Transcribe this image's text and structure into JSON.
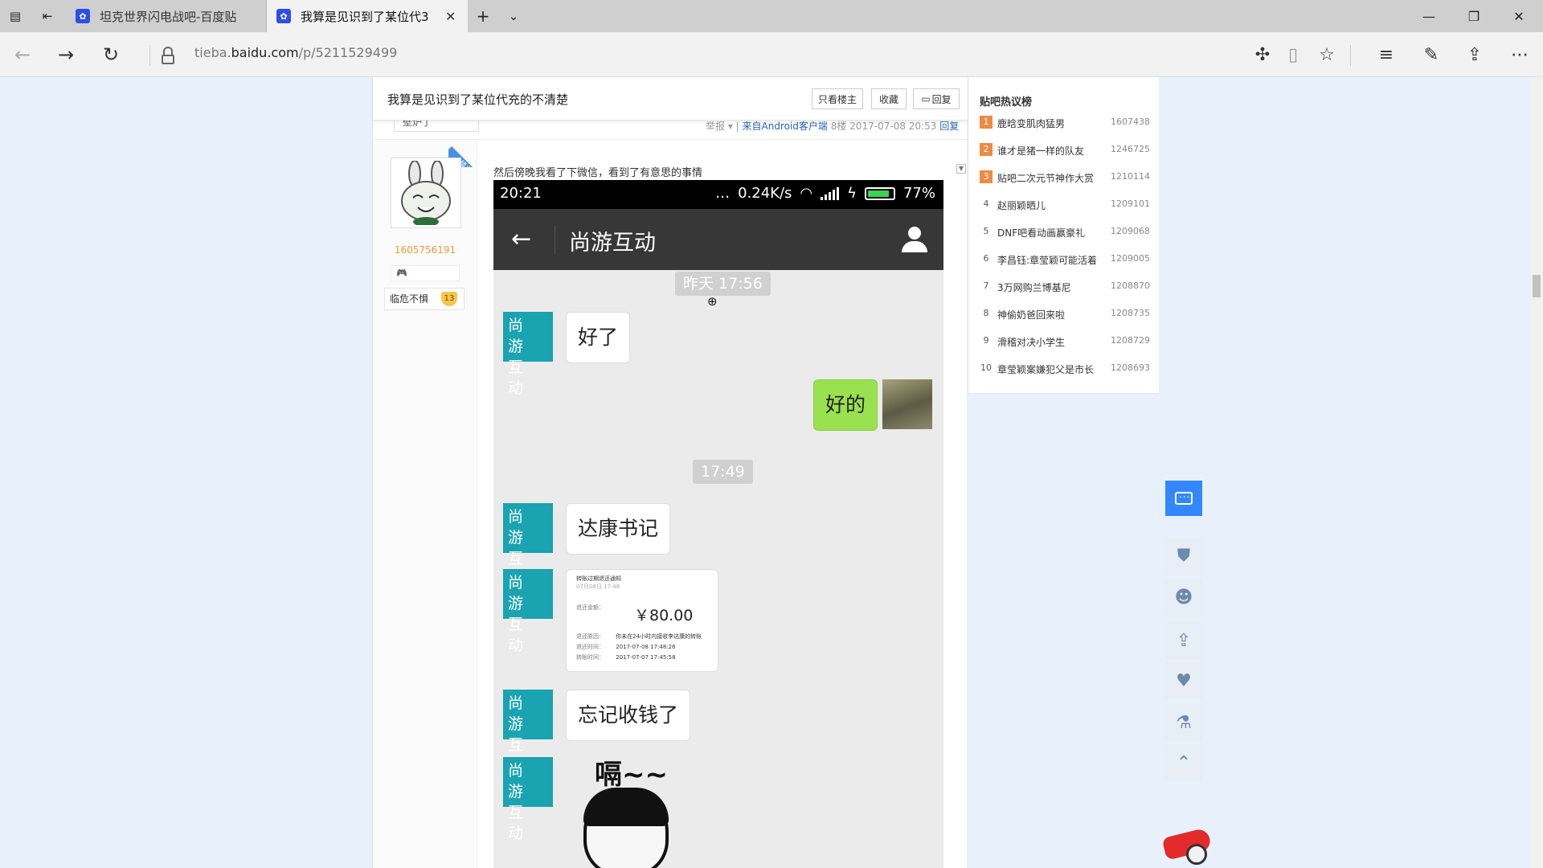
{
  "browser": {
    "tabs": [
      {
        "label": "坦克世界闪电战吧-百度贴吧",
        "active": false
      },
      {
        "label": "我算是见识到了某位代3",
        "active": true
      }
    ],
    "url_prefix": "tieba.",
    "url_domain": "baidu.com",
    "url_path": "/p/5211529499"
  },
  "thread": {
    "title": "我算是见识到了某位代充的不清楚",
    "buttons": {
      "only_op": "只看楼主",
      "favorite": "收藏",
      "reply": "回复"
    },
    "prev_meta": {
      "user": "壁炉了",
      "report": "举报",
      "from": "来自Android客户端",
      "floor": "8楼",
      "time": "2017-07-08 20:53",
      "reply": "回复"
    }
  },
  "post": {
    "username": "1605756191",
    "tag": "楼主",
    "badge2": "临危不惧",
    "level": "13",
    "text": "然后傍晚我看了下微信，看到了有意思的事情"
  },
  "screenshot": {
    "status_time": "20:21",
    "status_speed": "0.24K/s",
    "battery": "77%",
    "chat_title": "尚游互动",
    "ts1": "昨天 17:56",
    "ts2": "17:49",
    "avatar_text": "尚游互动",
    "msg1": "好了",
    "msg_me": "好的",
    "msg3": "达康书记",
    "receipt": {
      "title": "转账过期退还通知",
      "date": "07月08日 17:48",
      "label_amount": "退还金额：",
      "amount": "￥80.00",
      "reason_label": "退还原因：",
      "reason": "你未在24小时内接收李达康的转账",
      "time_label": "退还时间：",
      "time": "2017-07-08 17:48:26",
      "send_label": "转账时间：",
      "send": "2017-07-07 17:45:58"
    },
    "msg5": "忘记收钱了",
    "meme": "嗝~~"
  },
  "sidebar": {
    "title": "贴吧热议榜",
    "items": [
      {
        "rank": "1",
        "name": "鹿晗变肌肉猛男",
        "count": "1607438"
      },
      {
        "rank": "2",
        "name": "谁才是猪一样的队友",
        "count": "1246725"
      },
      {
        "rank": "3",
        "name": "贴吧二次元节神作大赏",
        "count": "1210114"
      },
      {
        "rank": "4",
        "name": "赵丽颖晒儿",
        "count": "1209101"
      },
      {
        "rank": "5",
        "name": "DNF吧看动画赢豪礼",
        "count": "1209068"
      },
      {
        "rank": "6",
        "name": "李昌钰:章莹颖可能活着",
        "count": "1209005"
      },
      {
        "rank": "7",
        "name": "3万网购兰博基尼",
        "count": "1208870"
      },
      {
        "rank": "8",
        "name": "神偷奶爸回来啦",
        "count": "1208735"
      },
      {
        "rank": "9",
        "name": "滑稽对决小学生",
        "count": "1208729"
      },
      {
        "rank": "10",
        "name": "章莹颖案嫌犯父是市长",
        "count": "1208693"
      }
    ]
  },
  "colors": {
    "accent": "#3388ff",
    "hot": "#ee8a43",
    "teal": "#1aa3b1",
    "green_bubble": "#9ae14f"
  }
}
